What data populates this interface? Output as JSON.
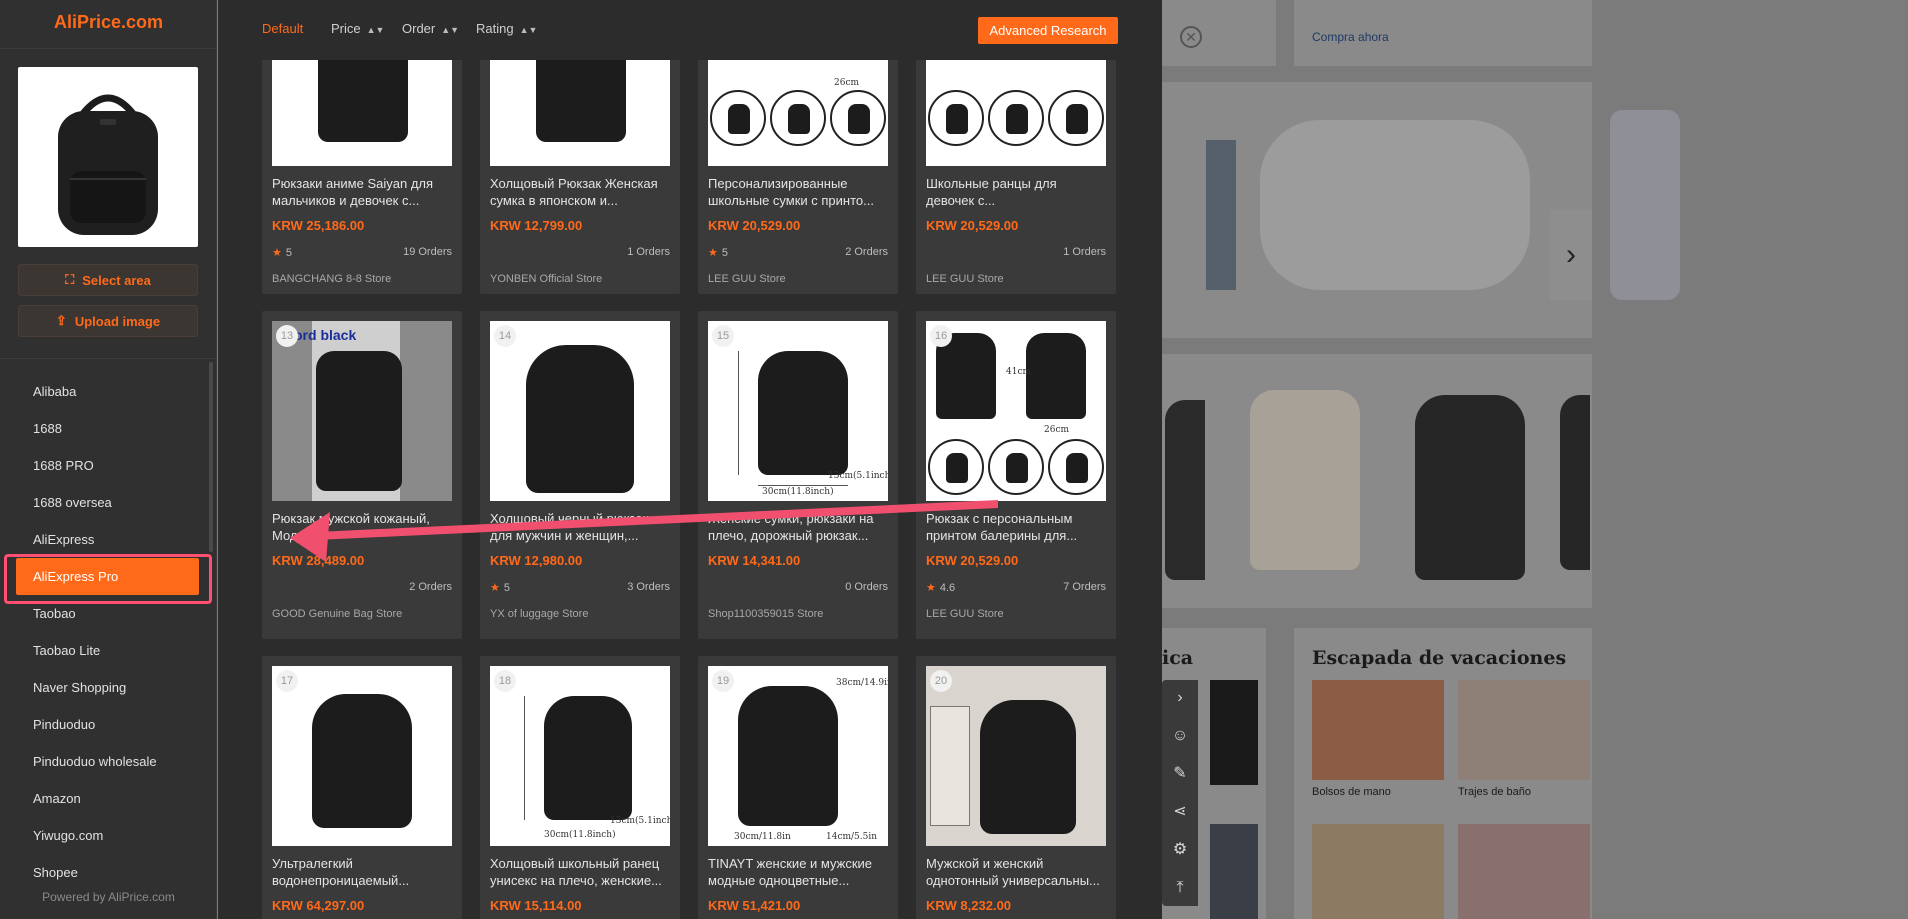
{
  "sidebar": {
    "brand": "AliPrice.com",
    "select_area_label": "Select area",
    "upload_label": "Upload image",
    "sources": [
      "Alibaba",
      "1688",
      "1688 PRO",
      "1688 oversea",
      "AliExpress",
      "AliExpress Pro",
      "Taobao",
      "Taobao Lite",
      "Naver Shopping",
      "Pinduoduo",
      "Pinduoduo wholesale",
      "Amazon",
      "Yiwugo.com",
      "Shopee"
    ],
    "active_source": "AliExpress Pro",
    "powered_by": "Powered by AliPrice.com"
  },
  "toolbar": {
    "sort_default": "Default",
    "sort_price": "Price",
    "sort_order": "Order",
    "sort_rating": "Rating",
    "advanced_label": "Advanced Research"
  },
  "results": [
    {
      "rank": "",
      "title": "Рюкзаки аниме Saiyan для мальчиков и девочек с...",
      "price": "KRW 25,186.00",
      "rating": "5",
      "orders": "19 Orders",
      "store": "BANGCHANG 8-8 Store"
    },
    {
      "rank": "",
      "title": "Холщовый Рюкзак Женская сумка в японском и...",
      "price": "KRW 12,799.00",
      "rating": "",
      "orders": "1 Orders",
      "store": "YONBEN Official Store"
    },
    {
      "rank": "",
      "title": "Персонализированные школьные сумки с принто...",
      "price": "KRW 20,529.00",
      "rating": "5",
      "orders": "2 Orders",
      "store": "LEE GUU Store"
    },
    {
      "rank": "",
      "title": "Школьные ранцы для девочек с...",
      "price": "KRW 20,529.00",
      "rating": "",
      "orders": "1 Orders",
      "store": "LEE GUU Store"
    },
    {
      "rank": "13",
      "title": "Рюкзак мужской кожаный, Модн...",
      "price": "KRW 28,489.00",
      "rating": "",
      "orders": "2 Orders",
      "store": "GOOD Genuine Bag Store",
      "thumb_text": "ord black"
    },
    {
      "rank": "14",
      "title": "Холщовый черный рюкзак для мужчин и женщин,...",
      "price": "KRW 12,980.00",
      "rating": "5",
      "orders": "3 Orders",
      "store": "YX of luggage Store"
    },
    {
      "rank": "15",
      "title": "Женские сумки, рюкзаки на плечо, дорожный рюкзак...",
      "price": "KRW 14,341.00",
      "rating": "",
      "orders": "0 Orders",
      "store": "Shop1100359015 Store"
    },
    {
      "rank": "16",
      "title": "Рюкзак с персональным принтом балерины для...",
      "price": "KRW 20,529.00",
      "rating": "4.6",
      "orders": "7 Orders",
      "store": "LEE GUU Store"
    },
    {
      "rank": "17",
      "title": "Ультралегкий водонепроницаемый...",
      "price": "KRW 64,297.00",
      "rating": "",
      "orders": "",
      "store": ""
    },
    {
      "rank": "18",
      "title": "Холщовый школьный ранец унисекс на плечо, женские...",
      "price": "KRW 15,114.00",
      "rating": "",
      "orders": "",
      "store": ""
    },
    {
      "rank": "19",
      "title": "TINAYT женские и мужские модные одноцветные...",
      "price": "KRW 51,421.00",
      "rating": "",
      "orders": "",
      "store": ""
    },
    {
      "rank": "20",
      "title": "Мужской и женский однотонный универсальны...",
      "price": "KRW 8,232.00",
      "rating": "",
      "orders": "",
      "store": ""
    }
  ],
  "background_page": {
    "link": "Compra ahora",
    "heading_left": "ica",
    "heading_right": "Escapada de vacaciones",
    "caption_1": "Bolsos de mano",
    "caption_2": "Trajes de baño"
  },
  "colors": {
    "accent": "#ff6a1a",
    "highlight_outline": "#ff4f72",
    "panel_bg": "#2c2c2c",
    "card_bg": "#3a3a3a"
  },
  "icons": {
    "tools": [
      "chevron-right-icon",
      "smile-icon",
      "edit-icon",
      "share-icon",
      "settings-icon",
      "back-to-top-icon"
    ]
  }
}
